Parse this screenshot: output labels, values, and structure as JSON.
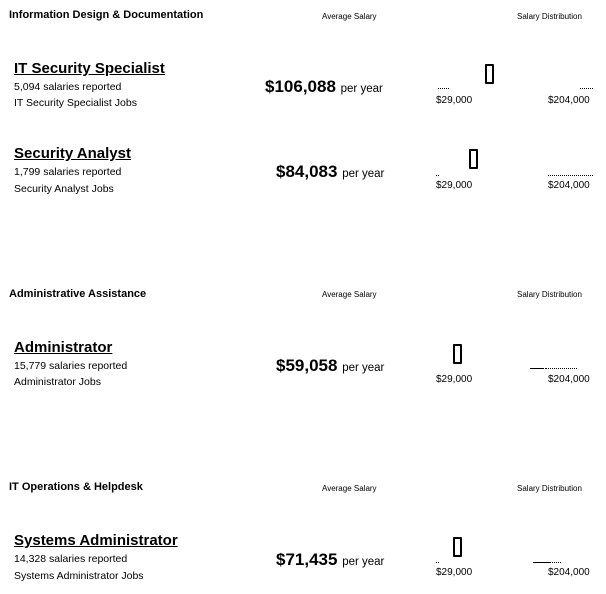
{
  "sections": [
    {
      "category": "Information Design & Documentation",
      "col_avg": "Average Salary",
      "col_dist": "Salary Distribution",
      "jobs": [
        {
          "title": "IT Security Specialist",
          "reports": "5,094 salaries reported",
          "jobs_link": "IT Security Specialist Jobs",
          "salary": "$106,088",
          "per": "per year",
          "min": "$29,000",
          "max": "$204,000",
          "marker_fraction": 0.3
        },
        {
          "title": "Security Analyst",
          "reports": "1,799 salaries reported",
          "jobs_link": "Security Analyst Jobs",
          "salary": "$84,083",
          "per": "per year",
          "min": "$29,000",
          "max": "$204,000",
          "marker_fraction": 0.2
        }
      ]
    },
    {
      "category": "Administrative Assistance",
      "col_avg": "Average Salary",
      "col_dist": "Salary Distribution",
      "jobs": [
        {
          "title": "Administrator",
          "reports": "15,779 salaries reported",
          "jobs_link": "Administrator Jobs",
          "salary": "$59,058",
          "per": "per year",
          "min": "$29,000",
          "max": "$204,000",
          "marker_fraction": 0.15
        }
      ]
    },
    {
      "category": "IT Operations & Helpdesk",
      "col_avg": "Average Salary",
      "col_dist": "Salary Distribution",
      "jobs": [
        {
          "title": "Systems Administrator",
          "reports": "14,328 salaries reported",
          "jobs_link": "Systems Administrator Jobs",
          "salary": "$71,435",
          "per": "per year",
          "min": "$29,000",
          "max": "$204,000",
          "marker_fraction": 0.15
        }
      ]
    }
  ]
}
